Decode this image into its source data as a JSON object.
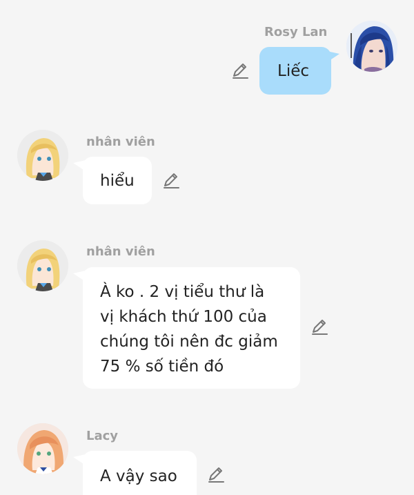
{
  "messages": [
    {
      "sender": "Rosy Lan",
      "text": "Liếc"
    },
    {
      "sender": "nhân viên",
      "text": "hiểu"
    },
    {
      "sender": "nhân viên",
      "lines": [
        "À ko . 2 vị tiểu thư là",
        "vị khách thứ 100 của",
        "chúng tôi nên đc giảm",
        "75 % số tiền đó"
      ]
    },
    {
      "sender": "Lacy",
      "text": "A vậy sao"
    }
  ],
  "icons": {
    "edit": "pencil-edit-icon",
    "avatar_rosy": "avatar-blue-hair",
    "avatar_staff": "avatar-blonde-girl",
    "avatar_lacy": "avatar-orange-hair"
  },
  "colors": {
    "background": "#f5f5f5",
    "bubble_left": "#ffffff",
    "bubble_right": "#a9dcfb",
    "name_text": "#a0a0a0",
    "icon": "#777777"
  }
}
